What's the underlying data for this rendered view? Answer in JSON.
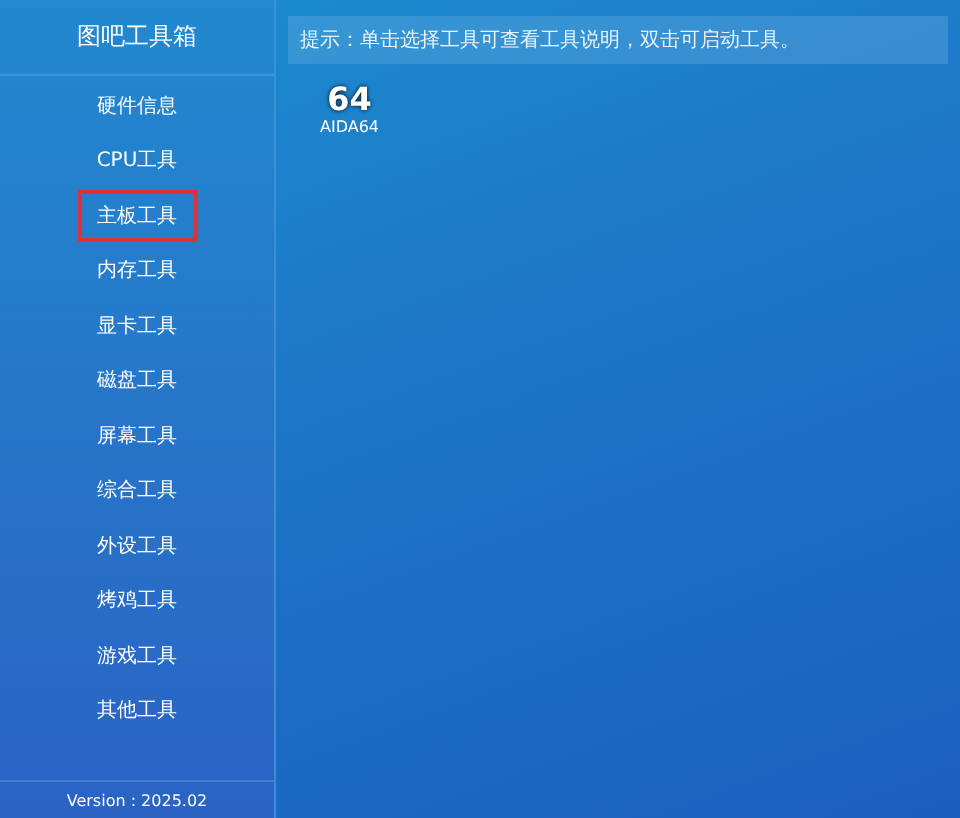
{
  "sidebar": {
    "title": "图吧工具箱",
    "items": [
      {
        "label": "硬件信息",
        "selected": false
      },
      {
        "label": "CPU工具",
        "selected": false
      },
      {
        "label": "主板工具",
        "selected": true
      },
      {
        "label": "内存工具",
        "selected": false
      },
      {
        "label": "显卡工具",
        "selected": false
      },
      {
        "label": "磁盘工具",
        "selected": false
      },
      {
        "label": "屏幕工具",
        "selected": false
      },
      {
        "label": "综合工具",
        "selected": false
      },
      {
        "label": "外设工具",
        "selected": false
      },
      {
        "label": "烤鸡工具",
        "selected": false
      },
      {
        "label": "游戏工具",
        "selected": false
      },
      {
        "label": "其他工具",
        "selected": false
      }
    ],
    "version": "Version : 2025.02"
  },
  "hint": "提示：单击选择工具可查看工具说明，双击可启动工具。",
  "tools": [
    {
      "icon_text": "64",
      "label": "AIDA64"
    }
  ]
}
